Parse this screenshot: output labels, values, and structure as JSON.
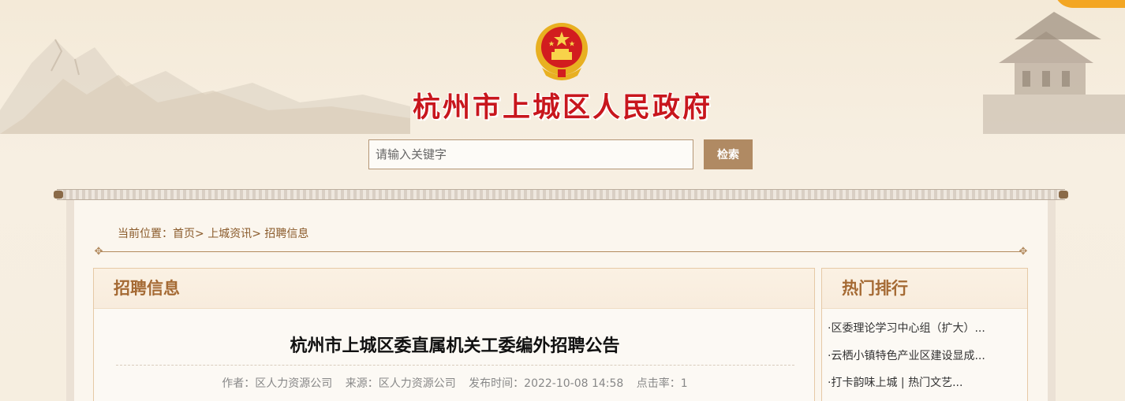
{
  "header": {
    "site_title": "杭州市上城区人民政府"
  },
  "search": {
    "placeholder": "请输入关键字",
    "button_label": "检索"
  },
  "breadcrumb": {
    "prefix": "当前位置：",
    "items": [
      "首页",
      "上城资讯",
      "招聘信息"
    ],
    "separator": ">"
  },
  "main": {
    "section_title": "招聘信息",
    "article": {
      "title": "杭州市上城区委直属机关工委编外招聘公告",
      "author_label": "作者：区人力资源公司",
      "source_label": "来源：区人力资源公司",
      "time_label": "发布时间：2022-10-08 14:58",
      "clicks_label": "点击率：1"
    }
  },
  "sidebar": {
    "section_title": "热门排行",
    "items": [
      "·区委理论学习中心组（扩大）...",
      "·云栖小镇特色产业区建设显成...",
      "·打卡韵味上城 | 热门文艺..."
    ]
  },
  "colors": {
    "title_red": "#c8161d",
    "accent_brown": "#a56a34",
    "button_bg": "#b08a63"
  },
  "icons": {
    "emblem": "national-emblem-icon",
    "divider_ornament": "ornament-icon"
  }
}
